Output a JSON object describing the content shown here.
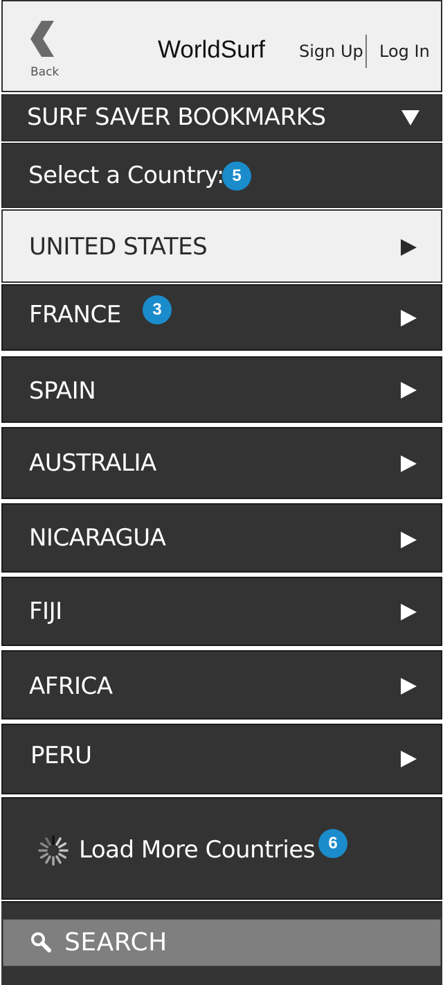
{
  "header": {
    "back_label": "Back",
    "title": "WorldSurf",
    "sign_up": "Sign Up",
    "log_in": "Log In"
  },
  "bookmarks_bar": {
    "label": "SURF SAVER BOOKMARKS",
    "icon": "dropdown-triangle-icon"
  },
  "select_country": {
    "label": "Select a Country:",
    "badge": "5"
  },
  "countries": [
    {
      "label": "UNITED STATES",
      "selected": true
    },
    {
      "label": "FRANCE",
      "badge": "3"
    },
    {
      "label": "SPAIN"
    },
    {
      "label": "AUSTRALIA"
    },
    {
      "label": "NICARAGUA"
    },
    {
      "label": "FIJI"
    },
    {
      "label": "AFRICA"
    },
    {
      "label": "PERU"
    }
  ],
  "load_more": {
    "label": "Load More Countries",
    "badge": "6",
    "icon": "spinner-icon"
  },
  "search": {
    "label": "SEARCH",
    "icon": "search-icon"
  },
  "colors": {
    "dark_row": "#333333",
    "selected_row": "#f0f0f0",
    "badge": "#1a8ccc",
    "search_bar": "#7f7f7f"
  }
}
